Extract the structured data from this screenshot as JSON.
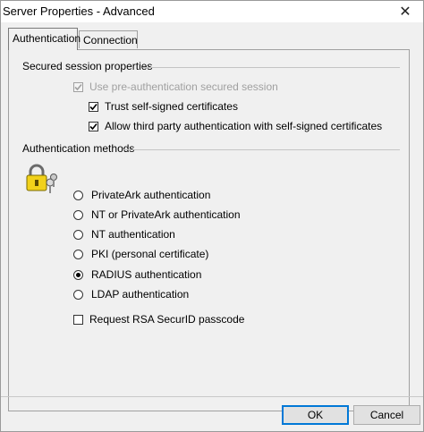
{
  "window": {
    "title": "Server Properties - Advanced",
    "close_glyph": "✕"
  },
  "tabs": [
    {
      "label": "Authentication",
      "active": true
    },
    {
      "label": "Connection",
      "active": false
    }
  ],
  "secured_session": {
    "group_label": "Secured session properties",
    "use_preauth": {
      "label": "Use pre-authentication secured session",
      "checked": true,
      "enabled": false
    },
    "trust_self_signed": {
      "label": "Trust self-signed certificates",
      "checked": true,
      "enabled": true
    },
    "allow_third_party": {
      "label": "Allow third party authentication with self-signed certificates",
      "checked": true,
      "enabled": true
    }
  },
  "auth_methods": {
    "group_label": "Authentication methods",
    "icon": "lock-keys-icon",
    "options": [
      {
        "label": "PrivateArk authentication",
        "selected": false
      },
      {
        "label": "NT or PrivateArk authentication",
        "selected": false
      },
      {
        "label": "NT authentication",
        "selected": false
      },
      {
        "label": "PKI (personal certificate)",
        "selected": false
      },
      {
        "label": "RADIUS authentication",
        "selected": true
      },
      {
        "label": "LDAP authentication",
        "selected": false
      }
    ],
    "rsa_securid": {
      "label": "Request RSA SecurID passcode",
      "checked": false
    }
  },
  "buttons": {
    "ok": "OK",
    "cancel": "Cancel"
  }
}
